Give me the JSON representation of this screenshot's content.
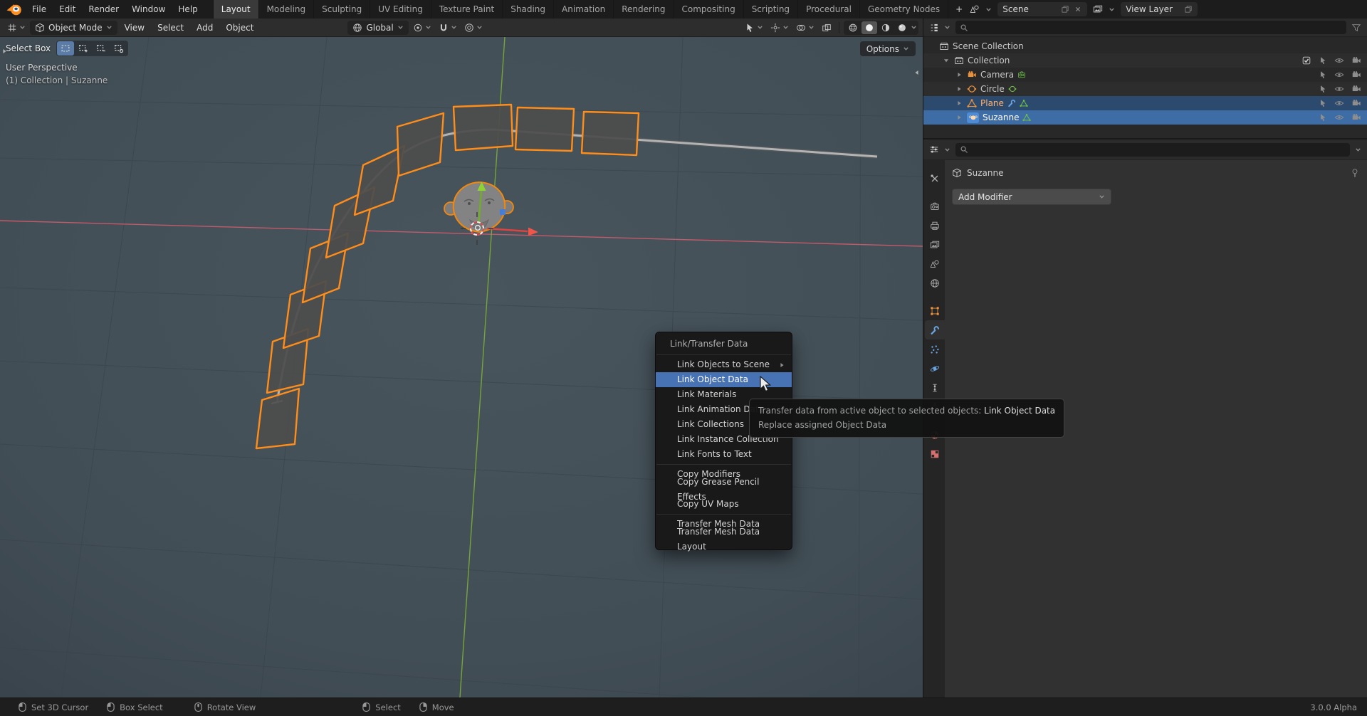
{
  "colors": {
    "accent": "#4772b3",
    "object_outline_orange": "#f5870a",
    "axis_x_red": "#cf5c6e",
    "axis_y_green": "#79a93a",
    "viewport_bg": "#42505b",
    "selected_row_blue": "#3e6da6"
  },
  "icons": {
    "dropdown": "chevron-down",
    "search": "magnifier",
    "snap": "magnet",
    "hide_toggle": "eye",
    "render_visibility": "camera",
    "selectability": "pointer",
    "filter": "funnel",
    "modifier": "wrench",
    "mesh_data": "triangle",
    "pin": "pin",
    "mouse_buttons": [
      "mouse-left",
      "mouse-middle",
      "mouse-right"
    ]
  },
  "topbar": {
    "menus": [
      "File",
      "Edit",
      "Render",
      "Window",
      "Help"
    ],
    "workspaces": [
      "Layout",
      "Modeling",
      "Sculpting",
      "UV Editing",
      "Texture Paint",
      "Shading",
      "Animation",
      "Rendering",
      "Compositing",
      "Scripting",
      "Procedural",
      "Geometry Nodes"
    ],
    "active_workspace": "Layout",
    "add_tab": "+",
    "scene": "Scene",
    "view_layer": "View Layer"
  },
  "viewport_header": {
    "mode": "Object Mode",
    "menus": [
      "View",
      "Select",
      "Add",
      "Object"
    ],
    "orientation": "Global",
    "options_label": "Options"
  },
  "viewport_overlay": {
    "tool": "Select Box",
    "view_label": "User Perspective",
    "context_label": "(1) Collection | Suzanne"
  },
  "context_menu": {
    "title": "Link/Transfer Data",
    "items": [
      {
        "label": "Link Objects to Scene",
        "submenu": true
      },
      {
        "label": "Link Object Data",
        "active": true
      },
      {
        "label": "Link Materials"
      },
      {
        "label": "Link Animation Data"
      },
      {
        "label": "Link Collections"
      },
      {
        "label": "Link Instance Collection"
      },
      {
        "label": "Link Fonts to Text"
      },
      {
        "label": "Copy Modifiers"
      },
      {
        "label": "Copy Grease Pencil Effects"
      },
      {
        "label": "Copy UV Maps"
      },
      {
        "label": "Transfer Mesh Data"
      },
      {
        "label": "Transfer Mesh Data Layout"
      }
    ]
  },
  "tooltip": {
    "description": "Transfer data from active object to selected objects:",
    "value": "Link Object Data",
    "subtext": "Replace assigned Object Data"
  },
  "outliner": {
    "rows": [
      {
        "label": "Scene Collection"
      },
      {
        "label": "Collection"
      },
      {
        "label": "Camera"
      },
      {
        "label": "Circle"
      },
      {
        "label": "Plane",
        "selected": true
      },
      {
        "label": "Suzanne",
        "active": true
      }
    ]
  },
  "properties": {
    "breadcrumb": "Suzanne",
    "add_modifier_label": "Add Modifier"
  },
  "statusbar": {
    "hints": [
      "Set 3D Cursor",
      "Box Select",
      "Rotate View",
      "Select",
      "Move"
    ],
    "version": "3.0.0 Alpha"
  }
}
